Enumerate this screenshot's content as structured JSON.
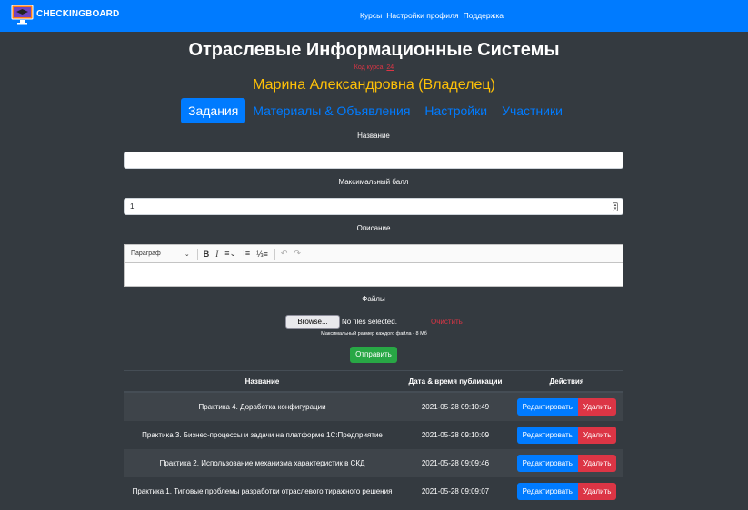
{
  "navbar": {
    "brand": "CHECKINGBOARD",
    "links": [
      "Курсы",
      "Настройки профиля",
      "Поддержка"
    ]
  },
  "course": {
    "title": "Отраслевые Информационные Системы",
    "code_label": "Код курса:",
    "code_value": "24",
    "owner": "Марина Александровна (Владелец)"
  },
  "tabs": [
    {
      "label": "Задания",
      "active": true
    },
    {
      "label": "Материалы & Объявления",
      "active": false
    },
    {
      "label": "Настройки",
      "active": false
    },
    {
      "label": "Участники",
      "active": false
    }
  ],
  "form": {
    "name_label": "Название",
    "name_value": "",
    "max_score_label": "Максимальный балл",
    "max_score_value": "1",
    "description_label": "Описание",
    "editor": {
      "paragraph_select": "Параграф",
      "buttons": [
        "bold-icon",
        "italic-icon",
        "align-icon",
        "bulleted-list-icon",
        "numbered-list-icon",
        "undo-icon",
        "redo-icon"
      ]
    },
    "files_label": "Файлы",
    "browse_label": "Browse...",
    "no_file_text": "No files selected.",
    "clear_label": "Очистить",
    "max_size_text": "Максимальный размер каждого файла - 8 Мб",
    "submit_label": "Отправить"
  },
  "table": {
    "headers": [
      "Название",
      "Дата & время публикации",
      "Действия"
    ],
    "rows": [
      {
        "name": "Практика 4. Доработка конфигурации",
        "date": "2021-05-28 09:10:49"
      },
      {
        "name": "Практика 3. Бизнес-процессы и задачи на платформе 1С:Предприятие",
        "date": "2021-05-28 09:10:09"
      },
      {
        "name": "Практика 2. Использование механизма характеристик в СКД",
        "date": "2021-05-28 09:09:46"
      },
      {
        "name": "Практика 1. Типовые проблемы разработки отраслевого тиражного решения",
        "date": "2021-05-28 09:09:07"
      }
    ],
    "edit_label": "Редактировать",
    "delete_label": "Удалить"
  },
  "colors": {
    "primary": "#007bff",
    "background": "#343a40",
    "owner": "#ffc107",
    "danger": "#dc3545",
    "success": "#28a745"
  }
}
